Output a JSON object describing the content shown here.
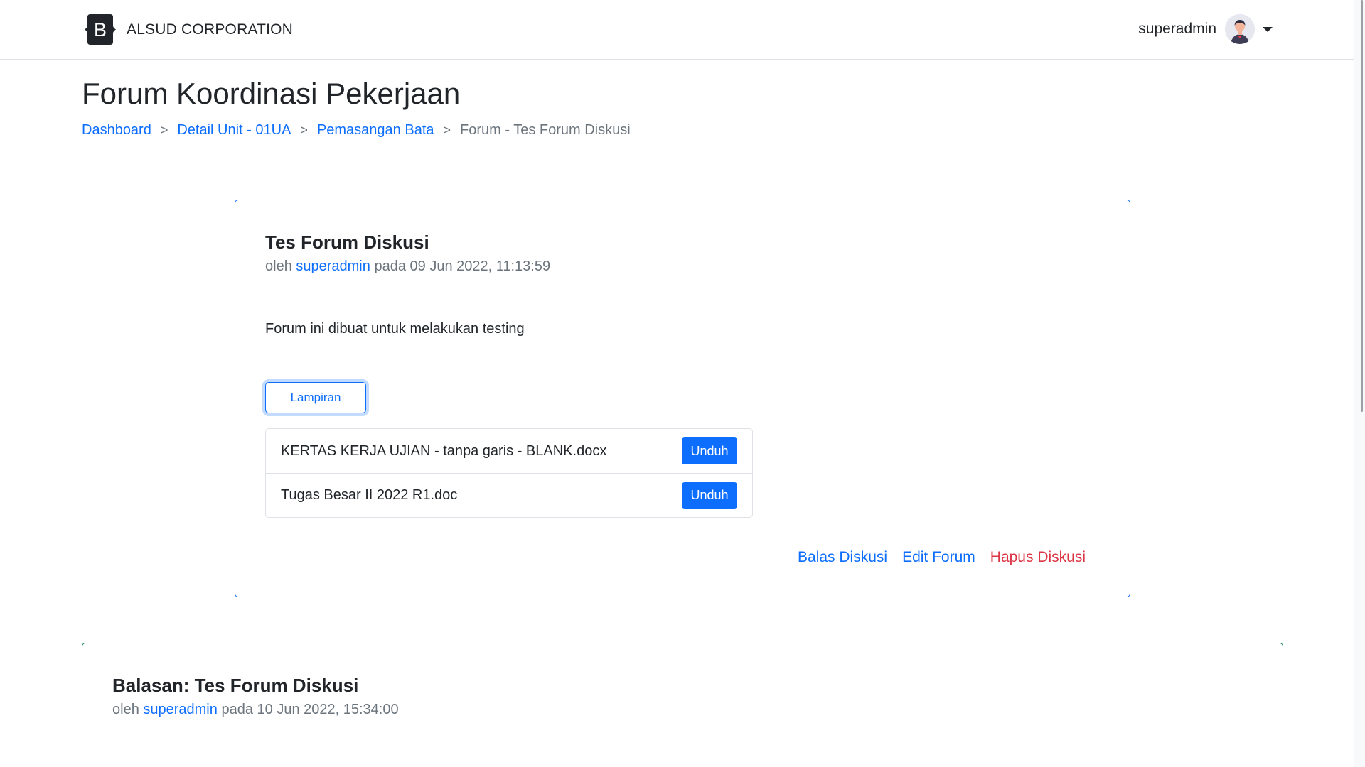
{
  "header": {
    "brand_letter": "B",
    "brand_name": "ALSUD CORPORATION",
    "username": "superadmin"
  },
  "page": {
    "title": "Forum Koordinasi Pekerjaan"
  },
  "breadcrumb": {
    "items": [
      "Dashboard",
      "Detail Unit - 01UA",
      "Pemasangan Bata"
    ],
    "separator": ">",
    "current": "Forum - Tes Forum Diskusi"
  },
  "post": {
    "title": "Tes Forum Diskusi",
    "meta_prefix": "oleh",
    "author": "superadmin",
    "meta_middle": "pada",
    "date": "09 Jun 2022, 11:13:59",
    "body": "Forum ini dibuat untuk melakukan testing",
    "attachments_button": "Lampiran",
    "attachments": [
      {
        "name": "KERTAS KERJA UJIAN - tanpa garis - BLANK.docx",
        "action": "Unduh"
      },
      {
        "name": "Tugas Besar II 2022 R1.doc",
        "action": "Unduh"
      }
    ],
    "actions": {
      "reply": "Balas Diskusi",
      "edit": "Edit Forum",
      "delete": "Hapus Diskusi"
    }
  },
  "reply": {
    "title": "Balasan: Tes Forum Diskusi",
    "meta_prefix": "oleh",
    "author": "superadmin",
    "meta_middle": "pada",
    "date": "10 Jun 2022, 15:34:00"
  },
  "colors": {
    "primary": "#0d6efd",
    "danger": "#dc3545",
    "reply_border": "#198754",
    "muted": "#6c757d"
  }
}
